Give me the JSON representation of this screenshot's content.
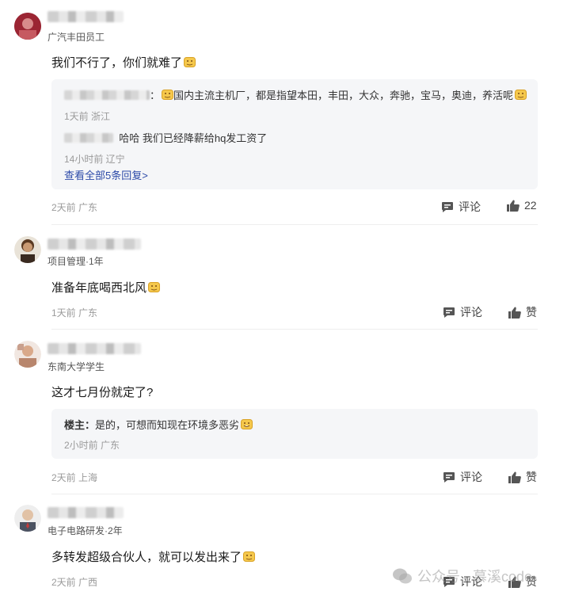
{
  "comments": [
    {
      "subtitle": "广汽丰田员工",
      "text": "我们不行了，你们就难了",
      "replies": [
        {
          "name_suffix": "：",
          "text": "国内主流主机厂，都是指望本田，丰田，大众，奔驰，宝马，奥迪，养活呢",
          "meta": "1天前 浙江"
        },
        {
          "text": "哈哈 我们已经降薪给hq发工资了",
          "meta": "14小时前 辽宁"
        }
      ],
      "view_all": "查看全部5条回复>",
      "meta": "2天前 广东",
      "comment_label": "评论",
      "like_label": "22"
    },
    {
      "subtitle": "项目管理·1年",
      "text": "准备年底喝西北风",
      "meta": "1天前 广东",
      "comment_label": "评论",
      "like_label": "赞"
    },
    {
      "subtitle": "东南大学学生",
      "text": "这才七月份就定了?",
      "replies": [
        {
          "author": "楼主：",
          "text": "是的，可想而知现在环境多恶劣",
          "meta": "2小时前 广东"
        }
      ],
      "meta": "2天前 上海",
      "comment_label": "评论",
      "like_label": "赞"
    },
    {
      "subtitle": "电子电路研发·2年",
      "text": "多转发超级合伙人，就可以发出来了",
      "meta": "2天前 广西",
      "comment_label": "评论",
      "like_label": "赞"
    }
  ],
  "watermark": "公众号 · 慕溪code",
  "colors": {
    "link": "#2c4aa8",
    "meta": "#9a9a9a",
    "reply_bg": "#f5f6f8",
    "emoji": "#f5c84c"
  }
}
